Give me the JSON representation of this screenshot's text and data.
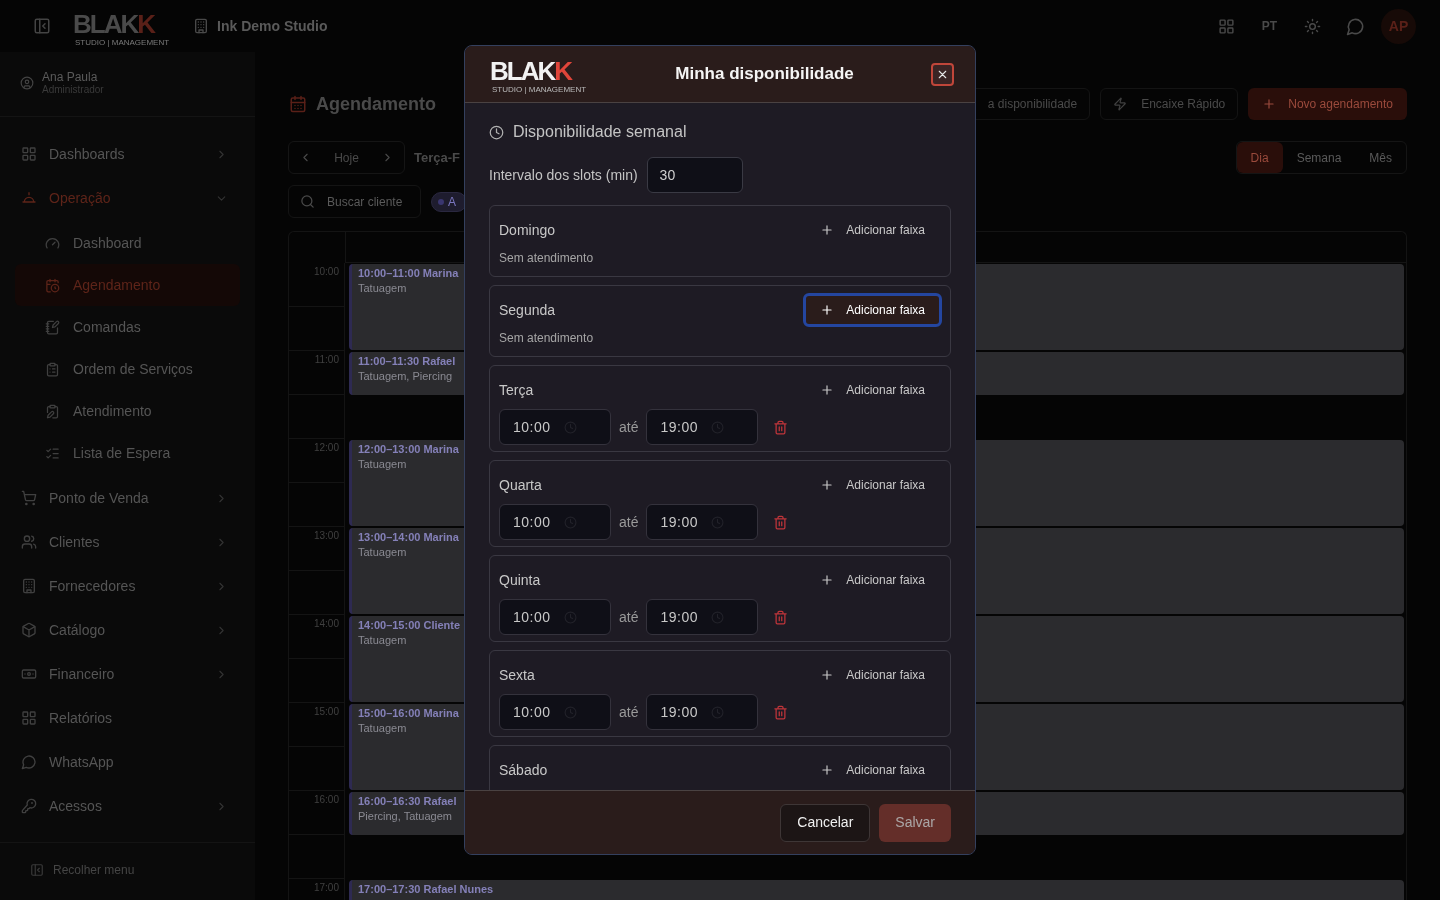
{
  "topbar": {
    "logo": {
      "text": "BLAK",
      "accent": "K",
      "tagline": "STUDIO | MANAGEMENT"
    },
    "workspace": "Ink Demo Studio",
    "language": "PT",
    "avatar": "AP"
  },
  "sidebar": {
    "user": {
      "name": "Ana Paula",
      "role": "Administrador"
    },
    "items": [
      {
        "label": "Dashboards",
        "kind": "group",
        "expanded": false,
        "selected": false
      },
      {
        "label": "Operação",
        "kind": "group",
        "expanded": true,
        "selected": true,
        "children": [
          {
            "label": "Dashboard",
            "selected": false
          },
          {
            "label": "Agendamento",
            "selected": true
          },
          {
            "label": "Comandas",
            "selected": false
          },
          {
            "label": "Ordem de Serviços",
            "selected": false
          },
          {
            "label": "Atendimento",
            "selected": false
          },
          {
            "label": "Lista de Espera",
            "selected": false
          }
        ]
      },
      {
        "label": "Ponto de Venda",
        "kind": "group",
        "expanded": false,
        "selected": false
      },
      {
        "label": "Clientes",
        "kind": "group",
        "expanded": false,
        "selected": false
      },
      {
        "label": "Fornecedores",
        "kind": "group",
        "expanded": false,
        "selected": false
      },
      {
        "label": "Catálogo",
        "kind": "group",
        "expanded": false,
        "selected": false
      },
      {
        "label": "Financeiro",
        "kind": "group",
        "expanded": false,
        "selected": false
      },
      {
        "label": "Relatórios",
        "kind": "link",
        "selected": false
      },
      {
        "label": "WhatsApp",
        "kind": "link",
        "selected": false
      },
      {
        "label": "Acessos",
        "kind": "group",
        "expanded": false,
        "selected": false
      }
    ],
    "collapse": "Recolher menu"
  },
  "page": {
    "title": "Agendamento",
    "actions": [
      {
        "label": "a disponibilidade",
        "kind": "outline"
      },
      {
        "label": "Encaixe Rápido",
        "kind": "outline"
      },
      {
        "label": "Novo agendamento",
        "kind": "primary"
      }
    ],
    "date_nav": {
      "today": "Hoje",
      "date": "Terça-F"
    },
    "views": [
      {
        "label": "Dia",
        "selected": true
      },
      {
        "label": "Semana",
        "selected": false
      },
      {
        "label": "Mês",
        "selected": false
      }
    ],
    "search": {
      "placeholder": "Buscar cliente"
    },
    "filter_chip": {
      "label": "A"
    },
    "calendar": {
      "hours": [
        {
          "label": "10:00",
          "events": [
            {
              "title": "10:00–11:00 Marina",
              "services": "Tatuagem",
              "kind": "hour"
            }
          ]
        },
        {
          "label": "11:00",
          "events": [
            {
              "title": "11:00–11:30 Rafael",
              "services": "Tatuagem, Piercing",
              "kind": "half"
            }
          ]
        },
        {
          "label": "12:00",
          "events": [
            {
              "title": "12:00–13:00 Marina",
              "services": "Tatuagem",
              "kind": "hour"
            }
          ]
        },
        {
          "label": "13:00",
          "events": [
            {
              "title": "13:00–14:00 Marina",
              "services": "Tatuagem",
              "kind": "hour"
            }
          ]
        },
        {
          "label": "14:00",
          "events": [
            {
              "title": "14:00–15:00 Cliente",
              "services": "Tatuagem",
              "kind": "hour"
            }
          ]
        },
        {
          "label": "15:00",
          "events": [
            {
              "title": "15:00–16:00 Marina",
              "services": "Tatuagem",
              "kind": "hour"
            }
          ]
        },
        {
          "label": "16:00",
          "events": [
            {
              "title": "16:00–16:30 Rafael",
              "services": "Piercing, Tatuagem",
              "kind": "half"
            }
          ]
        },
        {
          "label": "17:00",
          "events": [
            {
              "title": "17:00–17:30 Rafael Nunes",
              "kind": "half"
            }
          ]
        }
      ]
    }
  },
  "dialog": {
    "logo": {
      "text": "BLAK",
      "accent": "K",
      "tagline": "STUDIO | MANAGEMENT"
    },
    "title": "Minha disponibilidade",
    "section": "Disponibilidade semanal",
    "interval": {
      "label": "Intervalo dos slots (min)",
      "value": "30"
    },
    "days": [
      {
        "name": "Domingo",
        "add": {
          "label": "Adicionar faixa",
          "focused": false
        },
        "empty": "Sem atendimento"
      },
      {
        "name": "Segunda",
        "add": {
          "label": "Adicionar faixa",
          "focused": true
        },
        "empty": "Sem atendimento"
      },
      {
        "name": "Terça",
        "add": {
          "label": "Adicionar faixa",
          "focused": false
        },
        "ranges": [
          {
            "start": "10:00",
            "separator": "até",
            "end": "19:00"
          }
        ]
      },
      {
        "name": "Quarta",
        "add": {
          "label": "Adicionar faixa",
          "focused": false
        },
        "ranges": [
          {
            "start": "10:00",
            "separator": "até",
            "end": "19:00"
          }
        ]
      },
      {
        "name": "Quinta",
        "add": {
          "label": "Adicionar faixa",
          "focused": false
        },
        "ranges": [
          {
            "start": "10:00",
            "separator": "até",
            "end": "19:00"
          }
        ]
      },
      {
        "name": "Sexta",
        "add": {
          "label": "Adicionar faixa",
          "focused": false
        },
        "ranges": [
          {
            "start": "10:00",
            "separator": "até",
            "end": "19:00"
          }
        ]
      },
      {
        "name": "Sábado",
        "add": {
          "label": "Adicionar faixa",
          "focused": false
        }
      }
    ],
    "buttons": [
      {
        "label": "Cancelar",
        "kind": "secondary",
        "disabled": false
      },
      {
        "label": "Salvar",
        "kind": "primary",
        "disabled": true
      }
    ]
  }
}
